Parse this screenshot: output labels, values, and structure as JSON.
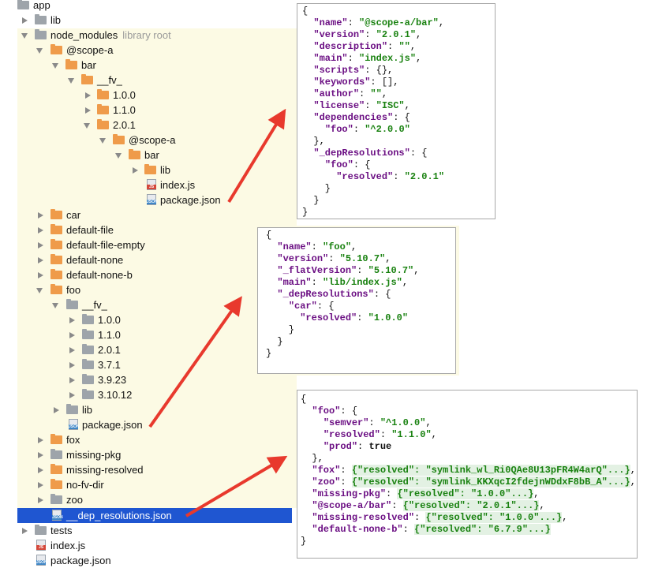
{
  "tree": {
    "app": "app",
    "lib": "lib",
    "node_modules": "node_modules",
    "library_root": "library root",
    "scope_a": "@scope-a",
    "bar": "bar",
    "fv": "__fv_",
    "v100": "1.0.0",
    "v110": "1.1.0",
    "v201": "2.0.1",
    "scope_a_inner": "@scope-a",
    "bar_inner": "bar",
    "lib_inner": "lib",
    "index_js_inner": "index.js",
    "package_json_inner": "package.json",
    "car": "car",
    "default_file": "default-file",
    "default_file_empty": "default-file-empty",
    "default_none": "default-none",
    "default_none_b": "default-none-b",
    "foo": "foo",
    "foo_fv": "__fv_",
    "foo_v100": "1.0.0",
    "foo_v110": "1.1.0",
    "foo_v201": "2.0.1",
    "foo_v371": "3.7.1",
    "foo_v3923": "3.9.23",
    "foo_v31012": "3.10.12",
    "foo_lib": "lib",
    "foo_package_json": "package.json",
    "fox": "fox",
    "missing_pkg": "missing-pkg",
    "missing_resolved": "missing-resolved",
    "no_fv_dir": "no-fv-dir",
    "zoo": "zoo",
    "dep_resolutions": "__dep_resolutions.json",
    "tests": "tests",
    "index_js": "index.js",
    "package_json": "package.json"
  },
  "panel1": {
    "l1": "{",
    "name_k": "\"name\"",
    "name_v": "\"@scope-a/bar\"",
    "version_k": "\"version\"",
    "version_v": "\"2.0.1\"",
    "description_k": "\"description\"",
    "description_v": "\"\"",
    "main_k": "\"main\"",
    "main_v": "\"index.js\"",
    "scripts_k": "\"scripts\"",
    "scripts_v": "{}",
    "keywords_k": "\"keywords\"",
    "keywords_v": "[]",
    "author_k": "\"author\"",
    "author_v": "\"\"",
    "license_k": "\"license\"",
    "license_v": "\"ISC\"",
    "dependencies_k": "\"dependencies\"",
    "foo_k": "\"foo\"",
    "foo_v": "\"^2.0.0\"",
    "depres_k": "\"_depResolutions\"",
    "foo2_k": "\"foo\"",
    "resolved_k": "\"resolved\"",
    "resolved_v": "\"2.0.1\""
  },
  "panel2": {
    "name_k": "\"name\"",
    "name_v": "\"foo\"",
    "version_k": "\"version\"",
    "version_v": "\"5.10.7\"",
    "flat_k": "\"_flatVersion\"",
    "flat_v": "\"5.10.7\"",
    "main_k": "\"main\"",
    "main_v": "\"lib/index.js\"",
    "depres_k": "\"_depResolutions\"",
    "car_k": "\"car\"",
    "resolved_k": "\"resolved\"",
    "resolved_v": "\"1.0.0\""
  },
  "panel3": {
    "foo_k": "\"foo\"",
    "semver_k": "\"semver\"",
    "semver_v": "\"^1.0.0\"",
    "resolved_k": "\"resolved\"",
    "resolved_v": "\"1.1.0\"",
    "prod_k": "\"prod\"",
    "prod_v": "true",
    "fox_k": "\"fox\"",
    "fox_v": "{\"resolved\": \"symlink_wl_Ri0QAe8U13pFR4W4arQ\"...}",
    "zoo_k": "\"zoo\"",
    "zoo_v": "{\"resolved\": \"symlink_KKXqcI2fdejnWDdxF8bB_A\"...}",
    "missing_pkg_k": "\"missing-pkg\"",
    "missing_pkg_v": "{\"resolved\": \"1.0.0\"...}",
    "scope_k": "\"@scope-a/bar\"",
    "scope_v": "{\"resolved\": \"2.0.1\"...}",
    "missing_res_k": "\"missing-resolved\"",
    "missing_res_v": "{\"resolved\": \"1.0.0\"...}",
    "dnb_k": "\"default-none-b\"",
    "dnb_v": "{\"resolved\": \"6.7.9\"...}"
  },
  "colors": {
    "folder": "#9ea4aa",
    "package_folder": "#ef9b4a",
    "selection": "#1f56d1",
    "arrow": "#e8392d",
    "key": "#6b0f83",
    "string": "#18810f"
  }
}
